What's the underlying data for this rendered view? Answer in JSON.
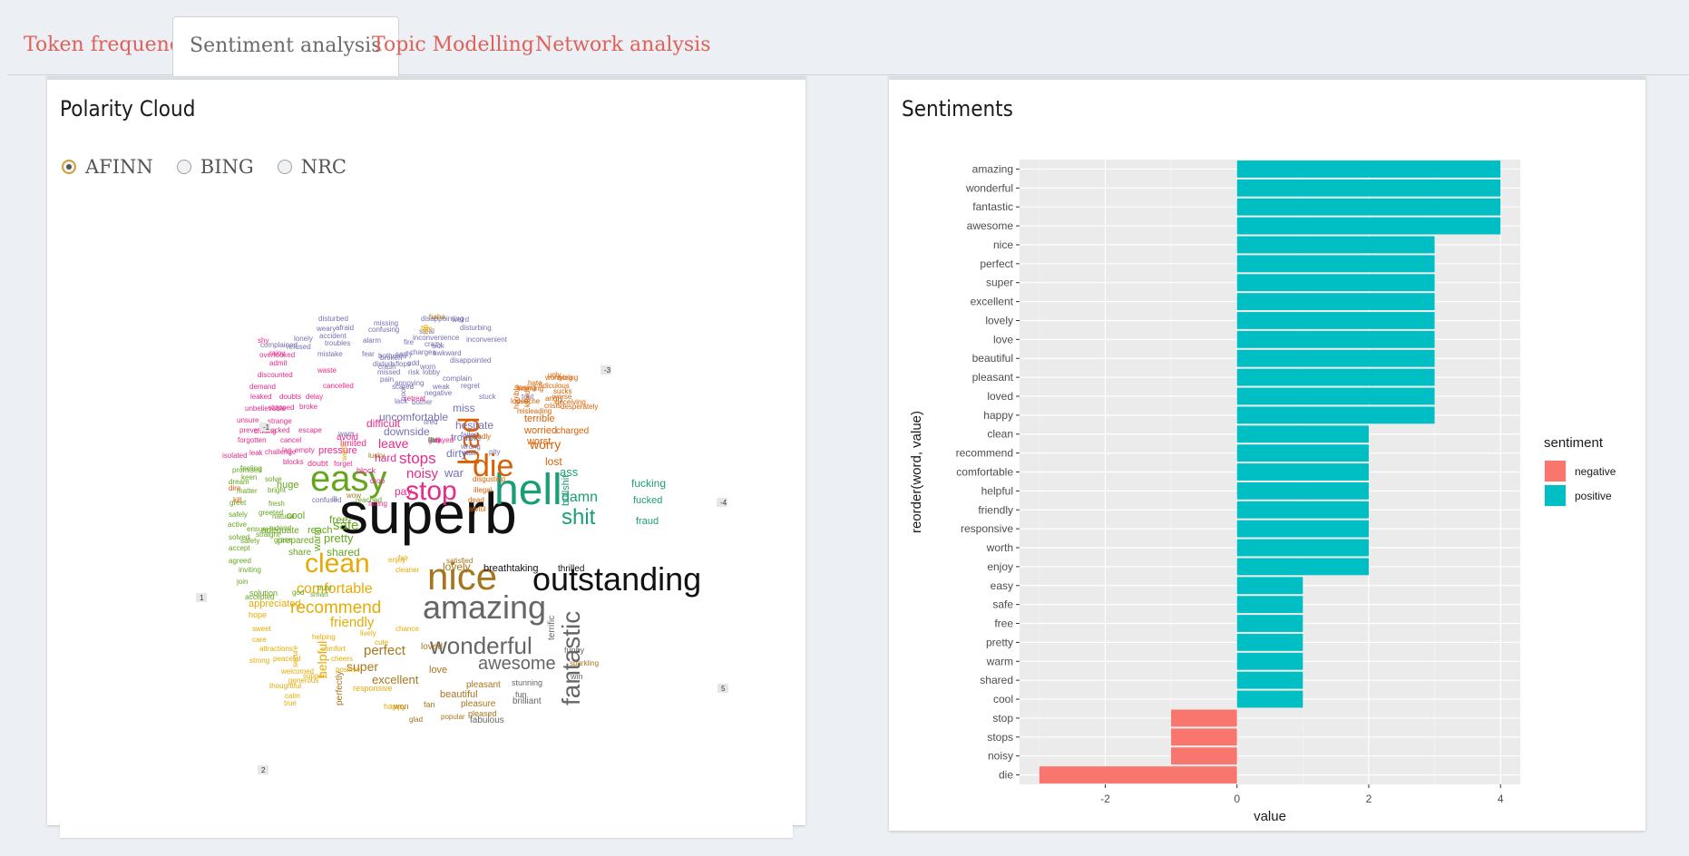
{
  "tabs": [
    {
      "label": "Token frequency",
      "active": false
    },
    {
      "label": "Sentiment analysis",
      "active": true
    },
    {
      "label": "Topic Modelling",
      "active": false
    },
    {
      "label": "Network analysis",
      "active": false
    }
  ],
  "left_panel": {
    "title": "Polarity Cloud",
    "options": [
      {
        "label": "AFINN",
        "checked": true
      },
      {
        "label": "BING",
        "checked": false
      },
      {
        "label": "NRC",
        "checked": false
      }
    ],
    "markers": [
      "-3",
      "-1",
      "-4",
      "1",
      "5",
      "2"
    ],
    "words": [
      {
        "t": "superb",
        "c": "#111111"
      },
      {
        "t": "outstanding",
        "c": "#111111"
      },
      {
        "t": "hell",
        "c": "#1b9e77"
      },
      {
        "t": "easy",
        "c": "#66a61e"
      },
      {
        "t": "nice",
        "c": "#a6761d"
      },
      {
        "t": "clean",
        "c": "#e6ab02"
      },
      {
        "t": "amazing",
        "c": "#666666"
      },
      {
        "t": "die",
        "c": "#d95f02"
      },
      {
        "t": "bad",
        "c": "#d95f02"
      },
      {
        "t": "stop",
        "c": "#e7298a"
      },
      {
        "t": "wonderful",
        "c": "#666666"
      },
      {
        "t": "fantastic",
        "c": "#666666"
      },
      {
        "t": "awesome",
        "c": "#666666"
      },
      {
        "t": "shit",
        "c": "#1b9e77"
      },
      {
        "t": "recommend",
        "c": "#e6ab02"
      },
      {
        "t": "damn",
        "c": "#1b9e77"
      },
      {
        "t": "stops",
        "c": "#e7298a"
      },
      {
        "t": "noisy",
        "c": "#e7298a"
      },
      {
        "t": "comfortable",
        "c": "#e6ab02"
      },
      {
        "t": "friendly",
        "c": "#e6ab02"
      },
      {
        "t": "perfect",
        "c": "#a6761d"
      },
      {
        "t": "super",
        "c": "#a6761d"
      },
      {
        "t": "excellent",
        "c": "#a6761d"
      },
      {
        "t": "helpful",
        "c": "#e6ab02"
      },
      {
        "t": "safe",
        "c": "#66a61e"
      },
      {
        "t": "pretty",
        "c": "#66a61e"
      },
      {
        "t": "shared",
        "c": "#66a61e"
      },
      {
        "t": "worry",
        "c": "#d95f02"
      },
      {
        "t": "ass",
        "c": "#1b9e77"
      },
      {
        "t": "fucking",
        "c": "#1b9e77"
      },
      {
        "t": "fucked",
        "c": "#1b9e77"
      },
      {
        "t": "fraud",
        "c": "#1b9e77"
      },
      {
        "t": "bullshit",
        "c": "#1b9e77"
      },
      {
        "t": "lost",
        "c": "#d95f02"
      },
      {
        "t": "leave",
        "c": "#e7298a"
      },
      {
        "t": "hard",
        "c": "#e7298a"
      },
      {
        "t": "pay",
        "c": "#e7298a"
      },
      {
        "t": "war",
        "c": "#7570b3"
      },
      {
        "t": "dirty",
        "c": "#7570b3"
      },
      {
        "t": "downside",
        "c": "#7570b3"
      },
      {
        "t": "uncomfortable",
        "c": "#7570b3"
      },
      {
        "t": "hesitate",
        "c": "#7570b3"
      },
      {
        "t": "trouble",
        "c": "#7570b3"
      },
      {
        "t": "miss",
        "c": "#7570b3"
      },
      {
        "t": "terrible",
        "c": "#d95f02"
      },
      {
        "t": "worried",
        "c": "#d95f02"
      },
      {
        "t": "worst",
        "c": "#d95f02"
      },
      {
        "t": "charged",
        "c": "#d95f02"
      },
      {
        "t": "difficult",
        "c": "#e7298a"
      },
      {
        "t": "pressure",
        "c": "#e7298a"
      },
      {
        "t": "avoid",
        "c": "#e7298a"
      },
      {
        "t": "limited",
        "c": "#e7298a"
      },
      {
        "t": "free",
        "c": "#66a61e"
      },
      {
        "t": "warm",
        "c": "#66a61e"
      },
      {
        "t": "reach",
        "c": "#66a61e"
      },
      {
        "t": "cool",
        "c": "#66a61e"
      },
      {
        "t": "huge",
        "c": "#66a61e"
      },
      {
        "t": "prepared",
        "c": "#66a61e"
      },
      {
        "t": "share",
        "c": "#66a61e"
      },
      {
        "t": "adequate",
        "c": "#66a61e"
      },
      {
        "t": "lovely",
        "c": "#a6761d"
      },
      {
        "t": "breathtaking",
        "c": "#111111"
      },
      {
        "t": "thrilled",
        "c": "#111111"
      },
      {
        "t": "love",
        "c": "#a6761d"
      },
      {
        "t": "loved",
        "c": "#a6761d"
      },
      {
        "t": "beautiful",
        "c": "#a6761d"
      },
      {
        "t": "pleasant",
        "c": "#a6761d"
      },
      {
        "t": "fabulous",
        "c": "#666666"
      },
      {
        "t": "brilliant",
        "c": "#666666"
      },
      {
        "t": "stunning",
        "c": "#666666"
      },
      {
        "t": "fun",
        "c": "#666666"
      },
      {
        "t": "terrific",
        "c": "#666666"
      },
      {
        "t": "funny",
        "c": "#666666"
      },
      {
        "t": "win",
        "c": "#666666"
      },
      {
        "t": "sparkling",
        "c": "#a6761d"
      },
      {
        "t": "pleasure",
        "c": "#a6761d"
      },
      {
        "t": "pleased",
        "c": "#a6761d"
      },
      {
        "t": "popular",
        "c": "#a6761d"
      },
      {
        "t": "won",
        "c": "#a6761d"
      },
      {
        "t": "fan",
        "c": "#a6761d"
      },
      {
        "t": "happy",
        "c": "#e6ab02"
      },
      {
        "t": "perfectly",
        "c": "#a6761d"
      },
      {
        "t": "responsive",
        "c": "#e6ab02"
      },
      {
        "t": "appreciated",
        "c": "#e6ab02"
      },
      {
        "t": "hope",
        "c": "#e6ab02"
      },
      {
        "t": "solution",
        "c": "#66a61e"
      },
      {
        "t": "accepted",
        "c": "#66a61e"
      },
      {
        "t": "join",
        "c": "#66a61e"
      },
      {
        "t": "inviting",
        "c": "#66a61e"
      },
      {
        "t": "agreed",
        "c": "#66a61e"
      },
      {
        "t": "accept",
        "c": "#66a61e"
      },
      {
        "t": "solved",
        "c": "#66a61e"
      },
      {
        "t": "active",
        "c": "#66a61e"
      },
      {
        "t": "safely",
        "c": "#66a61e"
      },
      {
        "t": "greet",
        "c": "#66a61e"
      },
      {
        "t": "matter",
        "c": "#66a61e"
      },
      {
        "t": "dream",
        "c": "#66a61e"
      },
      {
        "t": "promised",
        "c": "#66a61e"
      },
      {
        "t": "isolated",
        "c": "#e7298a"
      },
      {
        "t": "leak",
        "c": "#e7298a"
      },
      {
        "t": "challenge",
        "c": "#e7298a"
      },
      {
        "t": "blocks",
        "c": "#e7298a"
      },
      {
        "t": "doubt",
        "c": "#e7298a"
      },
      {
        "t": "forget",
        "c": "#e7298a"
      },
      {
        "t": "block",
        "c": "#e7298a"
      },
      {
        "t": "drop",
        "c": "#e7298a"
      },
      {
        "t": "falling",
        "c": "#e7298a"
      },
      {
        "t": "lag",
        "c": "#e7298a"
      },
      {
        "t": "empty",
        "c": "#e7298a"
      },
      {
        "t": "forgotten",
        "c": "#e7298a"
      },
      {
        "t": "chilling",
        "c": "#e7298a"
      },
      {
        "t": "cancel",
        "c": "#e7298a"
      },
      {
        "t": "prevent",
        "c": "#e7298a"
      },
      {
        "t": "blocked",
        "c": "#e7298a"
      },
      {
        "t": "escape",
        "c": "#e7298a"
      },
      {
        "t": "unsure",
        "c": "#e7298a"
      },
      {
        "t": "strange",
        "c": "#e7298a"
      },
      {
        "t": "unbelievable",
        "c": "#e7298a"
      },
      {
        "t": "stopped",
        "c": "#e7298a"
      },
      {
        "t": "broke",
        "c": "#e7298a"
      },
      {
        "t": "leaked",
        "c": "#e7298a"
      },
      {
        "t": "doubts",
        "c": "#e7298a"
      },
      {
        "t": "delay",
        "c": "#e7298a"
      },
      {
        "t": "demand",
        "c": "#e7298a"
      },
      {
        "t": "cancelled",
        "c": "#e7298a"
      },
      {
        "t": "discounted",
        "c": "#e7298a"
      },
      {
        "t": "admit",
        "c": "#e7298a"
      },
      {
        "t": "waste",
        "c": "#e7298a"
      },
      {
        "t": "rainy",
        "c": "#e7298a"
      },
      {
        "t": "shy",
        "c": "#e7298a"
      },
      {
        "t": "overlooked",
        "c": "#e7298a"
      },
      {
        "t": "complained",
        "c": "#7570b3"
      },
      {
        "t": "mistake",
        "c": "#7570b3"
      },
      {
        "t": "troubles",
        "c": "#7570b3"
      },
      {
        "t": "lonely",
        "c": "#7570b3"
      },
      {
        "t": "refused",
        "c": "#7570b3"
      },
      {
        "t": "accident",
        "c": "#7570b3"
      },
      {
        "t": "weary",
        "c": "#7570b3"
      },
      {
        "t": "disturbed",
        "c": "#7570b3"
      },
      {
        "t": "afraid",
        "c": "#7570b3"
      },
      {
        "t": "alarm",
        "c": "#7570b3"
      },
      {
        "t": "confusing",
        "c": "#7570b3"
      },
      {
        "t": "missing",
        "c": "#7570b3"
      },
      {
        "t": "fear",
        "c": "#7570b3"
      },
      {
        "t": "sadly",
        "c": "#7570b3"
      },
      {
        "t": "crazy",
        "c": "#7570b3"
      },
      {
        "t": "sick",
        "c": "#7570b3"
      },
      {
        "t": "inconvenience",
        "c": "#7570b3"
      },
      {
        "t": "steal",
        "c": "#7570b3"
      },
      {
        "t": "disappointing",
        "c": "#7570b3"
      },
      {
        "t": "weird",
        "c": "#7570b3"
      },
      {
        "t": "disturbing",
        "c": "#7570b3"
      },
      {
        "t": "inconvenient",
        "c": "#7570b3"
      },
      {
        "t": "awkward",
        "c": "#7570b3"
      },
      {
        "t": "disappointed",
        "c": "#7570b3"
      },
      {
        "t": "lobby",
        "c": "#7570b3"
      },
      {
        "t": "complain",
        "c": "#7570b3"
      },
      {
        "t": "regret",
        "c": "#7570b3"
      },
      {
        "t": "negative",
        "c": "#7570b3"
      },
      {
        "t": "bother",
        "c": "#7570b3"
      },
      {
        "t": "lack",
        "c": "#7570b3"
      },
      {
        "t": "tired",
        "c": "#7570b3"
      },
      {
        "t": "missed",
        "c": "#7570b3"
      },
      {
        "t": "scared",
        "c": "#7570b3"
      },
      {
        "t": "weak",
        "c": "#7570b3"
      },
      {
        "t": "annoying",
        "c": "#7570b3"
      },
      {
        "t": "disturb",
        "c": "#7570b3"
      },
      {
        "t": "flops",
        "c": "#7570b3"
      },
      {
        "t": "bothered",
        "c": "#7570b3"
      },
      {
        "t": "risk",
        "c": "#7570b3"
      },
      {
        "t": "odd",
        "c": "#7570b3"
      },
      {
        "t": "charges",
        "c": "#7570b3"
      },
      {
        "t": "pain",
        "c": "#7570b3"
      },
      {
        "t": "crash",
        "c": "#7570b3"
      },
      {
        "t": "broken",
        "c": "#7570b3"
      },
      {
        "t": "fire",
        "c": "#7570b3"
      },
      {
        "t": "worn",
        "c": "#7570b3"
      },
      {
        "t": "stuck",
        "c": "#7570b3"
      },
      {
        "t": "retreat",
        "c": "#e7298a"
      },
      {
        "t": "poor",
        "c": "#7570b3"
      },
      {
        "t": "failed",
        "c": "#7570b3"
      },
      {
        "t": "wrong",
        "c": "#7570b3"
      },
      {
        "t": "stall",
        "c": "#7570b3"
      },
      {
        "t": "pity",
        "c": "#7570b3"
      },
      {
        "t": "tout",
        "c": "#7570b3"
      },
      {
        "t": "angry",
        "c": "#d95f02"
      },
      {
        "t": "crisis",
        "c": "#d95f02"
      },
      {
        "t": "desperately",
        "c": "#d95f02"
      },
      {
        "t": "deceiving",
        "c": "#d95f02"
      },
      {
        "t": "hate",
        "c": "#d95f02"
      },
      {
        "t": "ugly",
        "c": "#d95f02"
      },
      {
        "t": "sucks",
        "c": "#d95f02"
      },
      {
        "t": "losing",
        "c": "#d95f02"
      },
      {
        "t": "boring",
        "c": "#d95f02"
      },
      {
        "t": "ridiculous",
        "c": "#d95f02"
      },
      {
        "t": "worrying",
        "c": "#d95f02"
      },
      {
        "t": "loose",
        "c": "#d95f02"
      },
      {
        "t": "misleading",
        "c": "#d95f02"
      },
      {
        "t": "douche",
        "c": "#d95f02"
      },
      {
        "t": "warning",
        "c": "#d95f02"
      },
      {
        "t": "worse",
        "c": "#d95f02"
      },
      {
        "t": "horrible",
        "c": "#d95f02"
      },
      {
        "t": "killed",
        "c": "#d95f02"
      },
      {
        "t": "badly",
        "c": "#d95f02"
      },
      {
        "t": "disgusting",
        "c": "#d95f02"
      },
      {
        "t": "illegal",
        "c": "#d95f02"
      },
      {
        "t": "dead",
        "c": "#d95f02"
      },
      {
        "t": "awful",
        "c": "#d95f02"
      },
      {
        "t": "kill",
        "c": "#d95f02"
      },
      {
        "t": "dire",
        "c": "#d95f02"
      },
      {
        "t": "keen",
        "c": "#66a61e"
      },
      {
        "t": "feeling",
        "c": "#66a61e"
      },
      {
        "t": "bright",
        "c": "#66a61e"
      },
      {
        "t": "solve",
        "c": "#66a61e"
      },
      {
        "t": "greeted",
        "c": "#66a61e"
      },
      {
        "t": "fresh",
        "c": "#66a61e"
      },
      {
        "t": "ensure",
        "c": "#66a61e"
      },
      {
        "t": "straight",
        "c": "#66a61e"
      },
      {
        "t": "safety",
        "c": "#66a61e"
      },
      {
        "t": "grace",
        "c": "#66a61e"
      },
      {
        "t": "extend",
        "c": "#66a61e"
      },
      {
        "t": "natural",
        "c": "#66a61e"
      },
      {
        "t": "reached",
        "c": "#66a61e"
      },
      {
        "t": "god",
        "c": "#66a61e"
      },
      {
        "t": "smart",
        "c": "#66a61e"
      },
      {
        "t": "trust",
        "c": "#66a61e"
      },
      {
        "t": "sweet",
        "c": "#e6ab02"
      },
      {
        "t": "care",
        "c": "#e6ab02"
      },
      {
        "t": "attractions",
        "c": "#e6ab02"
      },
      {
        "t": "strong",
        "c": "#e6ab02"
      },
      {
        "t": "peaceful",
        "c": "#e6ab02"
      },
      {
        "t": "thoughtful",
        "c": "#e6ab02"
      },
      {
        "t": "welcomed",
        "c": "#e6ab02"
      },
      {
        "t": "generous",
        "c": "#e6ab02"
      },
      {
        "t": "secure",
        "c": "#e6ab02"
      },
      {
        "t": "support",
        "c": "#e6ab02"
      },
      {
        "t": "calm",
        "c": "#e6ab02"
      },
      {
        "t": "true",
        "c": "#e6ab02"
      },
      {
        "t": "helping",
        "c": "#e6ab02"
      },
      {
        "t": "comfort",
        "c": "#e6ab02"
      },
      {
        "t": "cheers",
        "c": "#e6ab02"
      },
      {
        "t": "positive",
        "c": "#e6ab02"
      },
      {
        "t": "lively",
        "c": "#e6ab02"
      },
      {
        "t": "cute",
        "c": "#e6ab02"
      },
      {
        "t": "chance",
        "c": "#e6ab02"
      },
      {
        "t": "enjoy",
        "c": "#e6ab02"
      },
      {
        "t": "cleaner",
        "c": "#e6ab02"
      },
      {
        "t": "fair",
        "c": "#e6ab02"
      },
      {
        "t": "satisfied",
        "c": "#a6761d"
      },
      {
        "t": "glad",
        "c": "#a6761d"
      },
      {
        "t": "haha",
        "c": "#a6761d"
      },
      {
        "t": "top",
        "c": "#e6ab02"
      },
      {
        "t": "fine",
        "c": "#e6ab02"
      },
      {
        "t": "worth",
        "c": "#e6ab02"
      },
      {
        "t": "wow",
        "c": "#a6761d"
      },
      {
        "t": "lucky",
        "c": "#a6761d"
      },
      {
        "t": "ill",
        "c": "#7570b3"
      },
      {
        "t": "confused",
        "c": "#7570b3"
      },
      {
        "t": "warn",
        "c": "#7570b3"
      },
      {
        "t": "sad",
        "c": "#7570b3"
      },
      {
        "t": "delayed",
        "c": "#e7298a"
      },
      {
        "t": "gun",
        "c": "#e7298a"
      },
      {
        "t": "lazy",
        "c": "#e7298a"
      },
      {
        "t": "fit",
        "c": "#66a61e"
      },
      {
        "t": "ok",
        "c": "#66a61e"
      },
      {
        "t": "no",
        "c": "#7570b3"
      }
    ]
  },
  "right_panel": {
    "title": "Sentiments"
  },
  "chart_data": {
    "type": "bar",
    "orientation": "horizontal",
    "categories": [
      "amazing",
      "wonderful",
      "fantastic",
      "awesome",
      "nice",
      "perfect",
      "super",
      "excellent",
      "lovely",
      "love",
      "beautiful",
      "pleasant",
      "loved",
      "happy",
      "clean",
      "recommend",
      "comfortable",
      "helpful",
      "friendly",
      "responsive",
      "worth",
      "enjoy",
      "easy",
      "safe",
      "free",
      "pretty",
      "warm",
      "shared",
      "cool",
      "stop",
      "stops",
      "noisy",
      "die"
    ],
    "values": [
      4,
      4,
      4,
      4,
      3,
      3,
      3,
      3,
      3,
      3,
      3,
      3,
      3,
      3,
      2,
      2,
      2,
      2,
      2,
      2,
      2,
      2,
      1,
      1,
      1,
      1,
      1,
      1,
      1,
      -1,
      -1,
      -1,
      -3
    ],
    "sentiment": [
      "positive",
      "positive",
      "positive",
      "positive",
      "positive",
      "positive",
      "positive",
      "positive",
      "positive",
      "positive",
      "positive",
      "positive",
      "positive",
      "positive",
      "positive",
      "positive",
      "positive",
      "positive",
      "positive",
      "positive",
      "positive",
      "positive",
      "positive",
      "positive",
      "positive",
      "positive",
      "positive",
      "positive",
      "positive",
      "negative",
      "negative",
      "negative",
      "negative"
    ],
    "xlabel": "value",
    "ylabel": "reorder(word, value)",
    "xlim": [
      -3.3,
      4.3
    ],
    "xticks": [
      -2,
      0,
      2,
      4
    ],
    "xtick_labels": [
      "-2",
      "0",
      "2",
      "4"
    ],
    "legend": {
      "title": "sentiment",
      "placement": "right",
      "entries": [
        {
          "name": "negative",
          "color": "#f8766d"
        },
        {
          "name": "positive",
          "color": "#00bfc4"
        }
      ]
    },
    "panel_background": "#ebebeb",
    "grid": true
  }
}
